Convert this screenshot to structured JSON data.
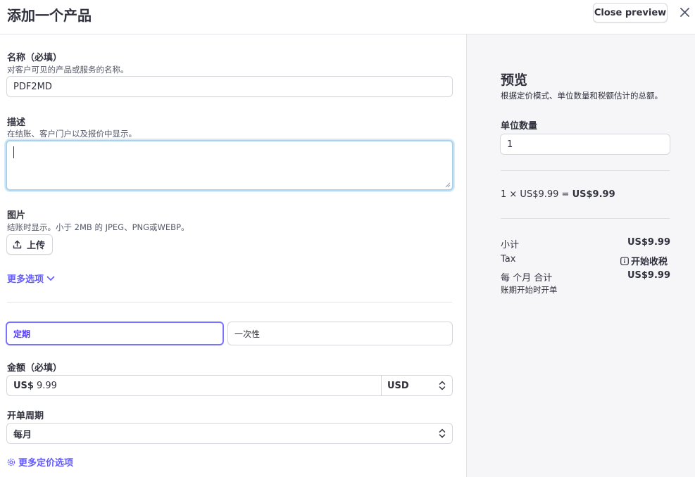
{
  "header": {
    "title": "添加一个产品",
    "close_preview_label": "Close preview"
  },
  "form": {
    "name": {
      "label": "名称（必填）",
      "help": "对客户可见的产品或服务的名称。",
      "value": "PDF2MD"
    },
    "description": {
      "label": "描述",
      "help": "在结账、客户门户以及报价中显示。",
      "value": ""
    },
    "image": {
      "label": "图片",
      "help": "结账时显示。小于 2MB 的 JPEG、PNG或WEBP。",
      "upload_label": "上传"
    },
    "more_options_label": "更多选项",
    "pricing_type": {
      "recurring_label": "定期",
      "one_time_label": "一次性",
      "selected": "定期"
    },
    "amount": {
      "label": "金额（必填）",
      "prefix": "US$",
      "value": "9.99",
      "currency": "USD"
    },
    "billing_period": {
      "label": "开单周期",
      "value": "每月"
    },
    "more_pricing_label": "更多定价选项"
  },
  "preview": {
    "title": "预览",
    "subtitle": "根据定价模式、单位数量和税额估计的总额。",
    "quantity_label": "单位数量",
    "quantity_value": "1",
    "calc_expression": "1 × US$9.99 = ",
    "calc_result": "US$9.99",
    "subtotal_label": "小计",
    "subtotal_value": "US$9.99",
    "tax_label": "Tax",
    "tax_link": "开始收税",
    "total_label": "每 个月 合计",
    "total_value": "US$9.99",
    "billing_note": "账期开始时开单"
  },
  "colors": {
    "accent": "#635bff",
    "focus_ring": "#a9d3ec",
    "panel_bg": "#f6f6f9"
  }
}
